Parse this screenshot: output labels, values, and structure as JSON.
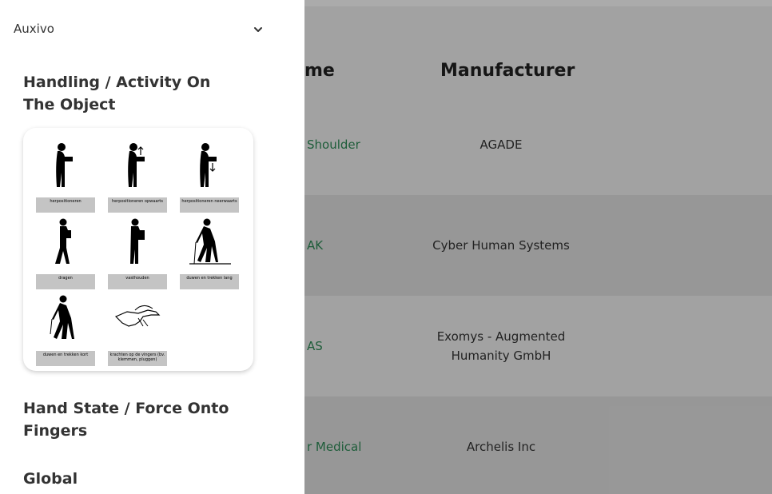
{
  "table": {
    "header_name_partial": "me",
    "header_manufacturer": "Manufacturer",
    "rows": [
      {
        "name_partial": "Shoulder",
        "manufacturer": "AGADE"
      },
      {
        "name_partial": "AK",
        "manufacturer": "Cyber Human Systems"
      },
      {
        "name_partial": "AS",
        "manufacturer_line1": "Exomys - Augmented",
        "manufacturer_line2": "Humanity GmbH"
      },
      {
        "name_partial": "r Medical",
        "manufacturer": "Archelis Inc"
      }
    ]
  },
  "sidebar": {
    "select_value": "Auxivo",
    "sections": [
      {
        "title": "Handling / Activity On The Object"
      },
      {
        "title": "Hand State / Force Onto Fingers"
      },
      {
        "title": "Global"
      }
    ],
    "pictograms": [
      {
        "label": "herpositioneren",
        "icon": "person-lifting-box-icon"
      },
      {
        "label": "herpositioneren opwaarts",
        "icon": "person-lifting-up-icon"
      },
      {
        "label": "herpositioneren neerwaarts",
        "icon": "person-lifting-down-icon"
      },
      {
        "label": "dragen",
        "icon": "person-carrying-icon"
      },
      {
        "label": "vasthouden",
        "icon": "person-holding-icon"
      },
      {
        "label": "duwen en trekken lang",
        "icon": "person-pushing-long-icon"
      },
      {
        "label": "duwen en trekken kort",
        "icon": "person-pushing-short-icon"
      },
      {
        "label": "krachten op de vingers (bv. klemmen, pluggen)",
        "icon": "hand-force-icon"
      }
    ]
  }
}
